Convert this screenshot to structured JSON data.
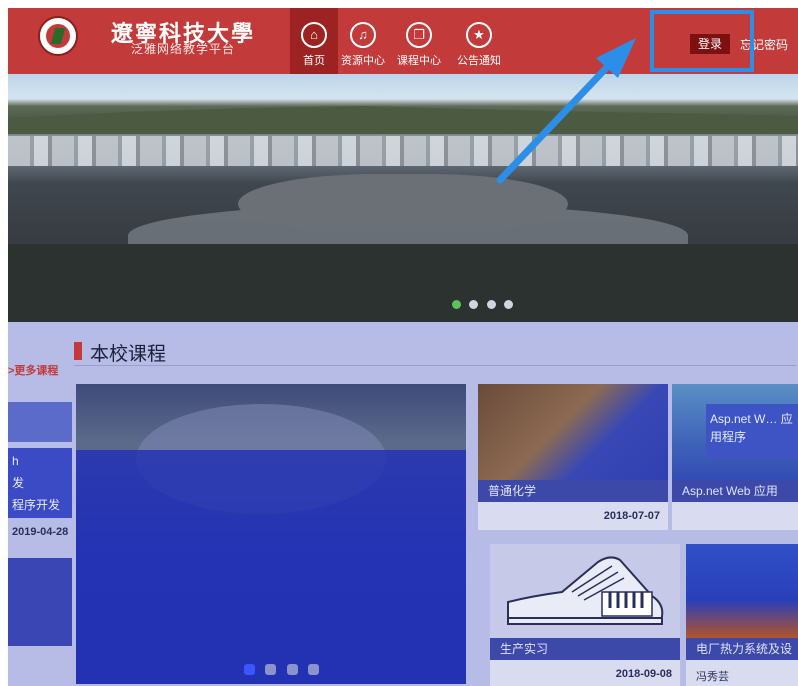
{
  "header": {
    "university_name": "遼寧科技大學",
    "platform_name": "泛雅网络教学平台",
    "nav": [
      {
        "label": "首页",
        "icon": "home-icon",
        "glyph": "⌂"
      },
      {
        "label": "资源中心",
        "icon": "bell-icon",
        "glyph": "♫"
      },
      {
        "label": "课程中心",
        "icon": "book-icon",
        "glyph": "❐"
      },
      {
        "label": "公告通知",
        "icon": "star-icon",
        "glyph": "★"
      }
    ],
    "login_label": "登录",
    "forgot_label": "忘记密码"
  },
  "hero": {
    "dots": 4,
    "active_dot": 0
  },
  "section": {
    "title": "本校课程",
    "more_label": ">更多课程"
  },
  "sidebar_cards": [
    {
      "lines": [
        "h",
        "发",
        "程序开发"
      ]
    },
    {
      "date": "2019-04-28"
    }
  ],
  "courses": [
    {
      "caption": "普通化学",
      "date": "2018-07-07"
    },
    {
      "caption": "Asp.net Web 应用",
      "badge": "Asp.net W… 应用程序"
    },
    {
      "caption": "生产实习",
      "date": "2018-09-08"
    },
    {
      "caption": "电厂热力系统及设",
      "sub": "冯秀芸"
    }
  ],
  "featured_dots": 4,
  "colors": {
    "header_bg": "#c23a3a",
    "nav_active": "#9d2222",
    "login_bg": "#7d1010",
    "highlight": "#2d8ee8",
    "overlay": "#b7bce6"
  }
}
